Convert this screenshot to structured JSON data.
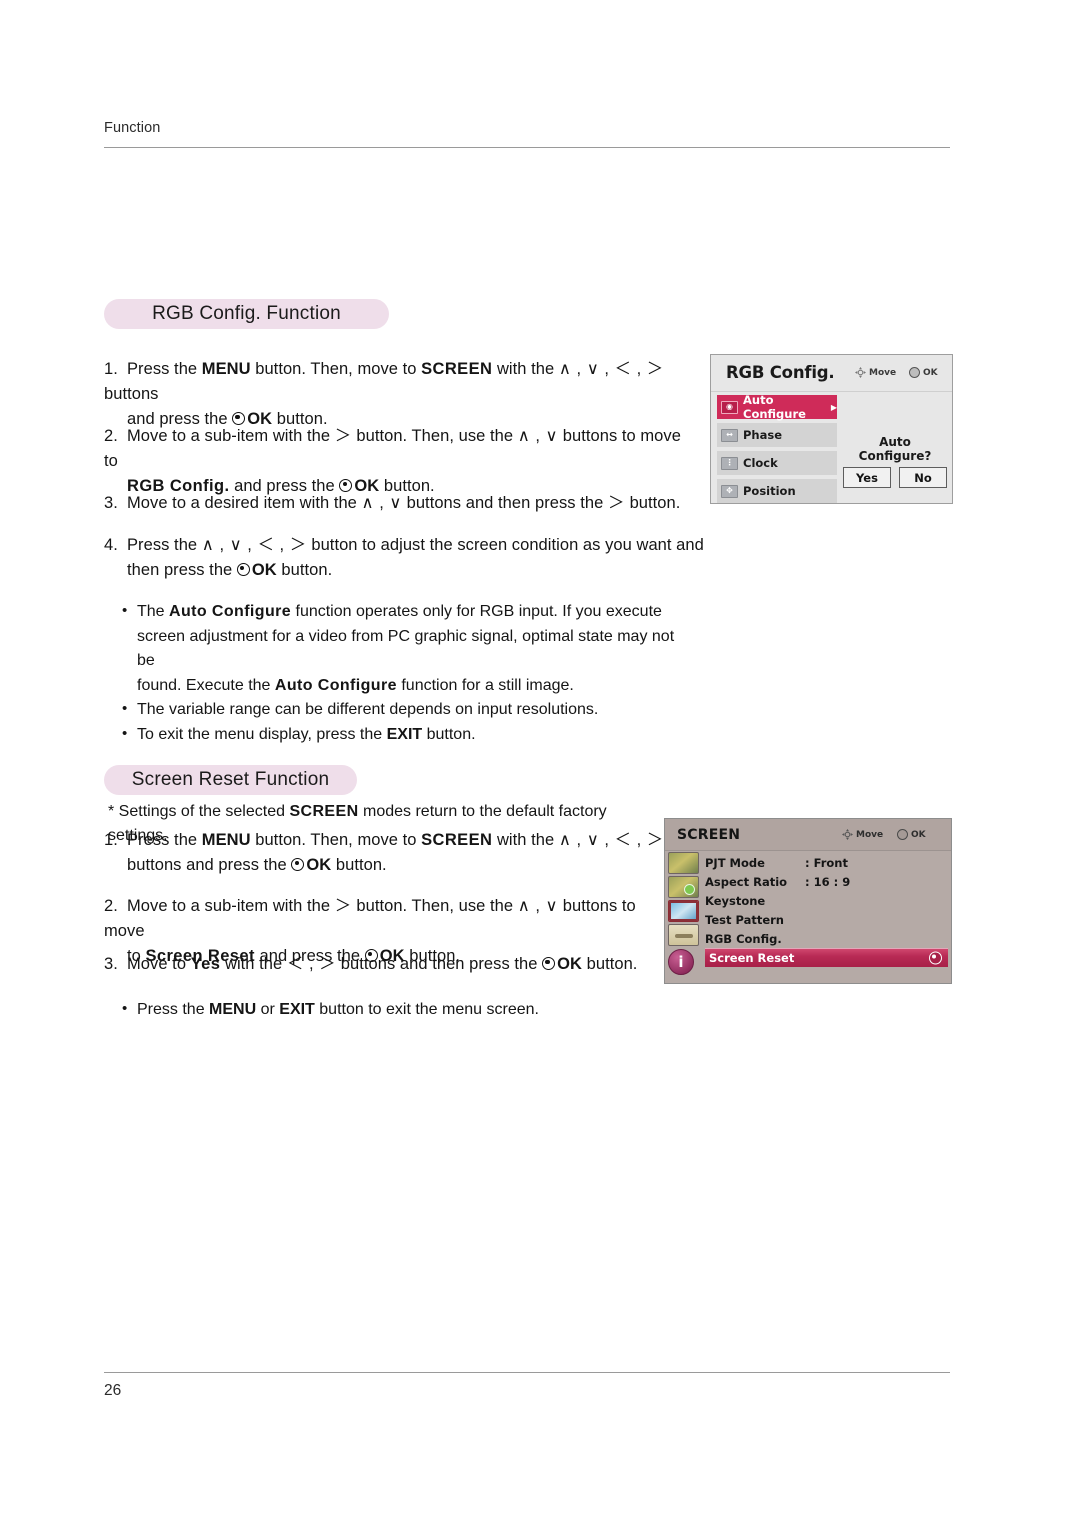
{
  "page": {
    "running_head": "Function",
    "number": "26"
  },
  "sections": {
    "rgb_config": {
      "banner": "RGB Config. Function",
      "steps": [
        {
          "num": "1.",
          "line1_a": "Press the ",
          "line1_b": "MENU",
          "line1_c": " button. Then, move to ",
          "line1_d": "SCREEN",
          "line1_e": " with the ",
          "line1_f": "∧ , ∨ , ＜ , ＞",
          "line1_g": " buttons",
          "line2_a": "and press the ",
          "line2_b": "OK",
          "line2_c": " button."
        },
        {
          "num": "2.",
          "line1_a": "Move to a sub-item with the ",
          "line1_b": "＞",
          "line1_c": " button. Then, use the ",
          "line1_d": "∧ , ∨",
          "line1_e": " buttons to move to",
          "line2_a": "RGB Config.",
          "line2_b": " and press the ",
          "line2_c": "OK",
          "line2_d": " button."
        },
        {
          "num": "3.",
          "line1_a": "Move to a desired item with the ",
          "line1_b": "∧ , ∨",
          "line1_c": " buttons and then press the ",
          "line1_d": "＞",
          "line1_e": " button."
        },
        {
          "num": "4.",
          "line1_a": "Press the ",
          "line1_b": "∧ , ∨ , ＜ , ＞",
          "line1_c": " button to adjust the screen condition as you want and",
          "line2_a": "then press the ",
          "line2_b": "OK",
          "line2_c": " button."
        }
      ],
      "notes": [
        {
          "a": "The ",
          "b": "Auto Configure",
          "c": " function operates only for RGB input. If you execute",
          "d": "screen adjustment for a video from PC graphic signal, optimal state may not be",
          "e": "found. Execute the ",
          "f": "Auto Configure",
          "g": " function for a still image."
        },
        {
          "a": "The variable range can be different depends on input resolutions."
        },
        {
          "a": "To exit the menu display, press the ",
          "b": "EXIT",
          "c": " button."
        }
      ]
    },
    "screen_reset": {
      "banner": "Screen Reset Function",
      "star_note_a": "* Settings of the selected ",
      "star_note_b": "SCREEN",
      "star_note_c": " modes return to the default factory settings.",
      "steps": [
        {
          "num": "1.",
          "line1_a": "Press the ",
          "line1_b": "MENU",
          "line1_c": " button. Then, move to ",
          "line1_d": "SCREEN",
          "line1_e": " with the ",
          "line1_f": "∧ , ∨ , ＜ , ＞",
          "line2_a": "buttons and press the ",
          "line2_b": "OK",
          "line2_c": " button."
        },
        {
          "num": "2.",
          "line1_a": "Move to a sub-item with the ",
          "line1_b": "＞",
          "line1_c": " button. Then, use the ",
          "line1_d": "∧ , ∨",
          "line1_e": " buttons to move",
          "line2_a": "to ",
          "line2_b": "Screen Reset",
          "line2_c": " and press the ",
          "line2_d": "OK",
          "line2_e": " button."
        },
        {
          "num": "3.",
          "line1_a": "Move to ",
          "line1_b": "Yes",
          "line1_c": " with the ",
          "line1_d": "＜ , ＞",
          "line1_e": " buttons and then press the ",
          "line1_f": "OK",
          "line1_g": " button."
        }
      ],
      "note": {
        "a": "Press the ",
        "b": "MENU",
        "c": " or ",
        "d": "EXIT",
        "e": " button to exit the menu screen."
      }
    }
  },
  "osd_rgb_config": {
    "title": "RGB Config.",
    "hint_move": "Move",
    "hint_ok": "OK",
    "items": [
      {
        "label": "Auto Configure",
        "icon": "auto-configure-icon",
        "selected": true,
        "caret": "▶"
      },
      {
        "label": "Phase",
        "icon": "phase-icon",
        "selected": false
      },
      {
        "label": "Clock",
        "icon": "clock-icon",
        "selected": false
      },
      {
        "label": "Position",
        "icon": "position-icon",
        "selected": false
      }
    ],
    "confirm_question": "Auto Configure?",
    "buttons": [
      {
        "label": "Yes"
      },
      {
        "label": "No"
      }
    ],
    "colors": {
      "panel_bg": "#e7e7e7",
      "item_bg": "#d3d3d3",
      "highlight": "#cf2b59"
    }
  },
  "osd_screen": {
    "title": "SCREEN",
    "hint_move": "Move",
    "hint_ok": "OK",
    "rows": [
      {
        "label": "PJT Mode",
        "value": ": Front",
        "selected": false
      },
      {
        "label": "Aspect Ratio",
        "value": ": 16 : 9",
        "selected": false
      },
      {
        "label": "Keystone",
        "value": "",
        "selected": false
      },
      {
        "label": "Test Pattern",
        "value": "",
        "selected": false
      },
      {
        "label": "RGB Config.",
        "value": "",
        "selected": false
      },
      {
        "label": "Screen Reset",
        "value": "",
        "selected": true
      }
    ],
    "sidebar_icons": [
      "picture-icon",
      "picture-plus-icon",
      "screen-icon",
      "toolbox-icon",
      "information-icon"
    ],
    "info_icon_glyph": "i",
    "colors": {
      "panel_bg": "#b5aaa6",
      "header_bg": "#b0a4a0",
      "highlight": "#b82a55"
    }
  }
}
